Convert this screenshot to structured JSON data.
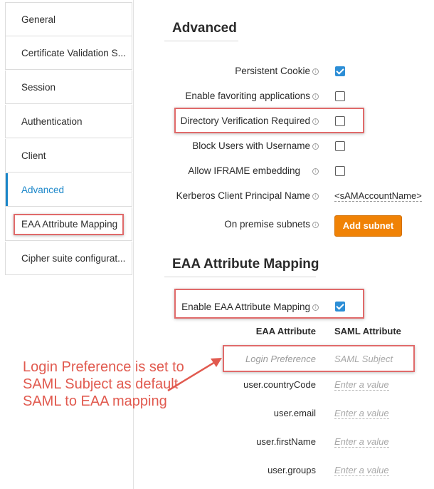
{
  "sidebar": {
    "items": [
      {
        "label": "General"
      },
      {
        "label": "Certificate Validation S..."
      },
      {
        "label": "Session"
      },
      {
        "label": "Authentication"
      },
      {
        "label": "Client"
      },
      {
        "label": "Advanced"
      },
      {
        "label": "EAA Attribute Mapping"
      },
      {
        "label": "Cipher suite configurat..."
      }
    ],
    "active_item": "Advanced",
    "accent_color": "#1a86c9"
  },
  "advanced": {
    "title": "Advanced",
    "rows": [
      {
        "label": "Persistent Cookie",
        "checked": true
      },
      {
        "label": "Enable favoriting applications",
        "checked": false
      },
      {
        "label": "Directory Verification Required",
        "checked": false
      },
      {
        "label": "Block Users with Username",
        "checked": false
      },
      {
        "label": "Allow IFRAME embedding",
        "checked": false
      },
      {
        "label": "Kerberos Client Principal Name",
        "value": "<sAMAccountName>"
      },
      {
        "label": "On premise subnets",
        "button": "Add subnet"
      }
    ]
  },
  "eaa_mapping": {
    "title": "EAA Attribute Mapping",
    "enable_label": "Enable EAA Attribute Mapping",
    "enable_checked": true,
    "col_eaa": "EAA Attribute",
    "col_saml": "SAML Attribute",
    "rows": [
      {
        "eaa": "Login Preference",
        "saml": "SAML Subject"
      },
      {
        "eaa": "user.countryCode",
        "saml": "Enter a value"
      },
      {
        "eaa": "user.email",
        "saml": "Enter a value"
      },
      {
        "eaa": "user.firstName",
        "saml": "Enter a value"
      },
      {
        "eaa": "user.groups",
        "saml": "Enter a value"
      }
    ]
  },
  "annotation": {
    "text": "Login Preference is set to SAML Subject as default SAML to EAA mapping",
    "color": "#e15a4f"
  },
  "colors": {
    "checkbox_checked": "#2c8ed6",
    "button_orange": "#f08205",
    "highlight_red": "#e06a6a"
  }
}
